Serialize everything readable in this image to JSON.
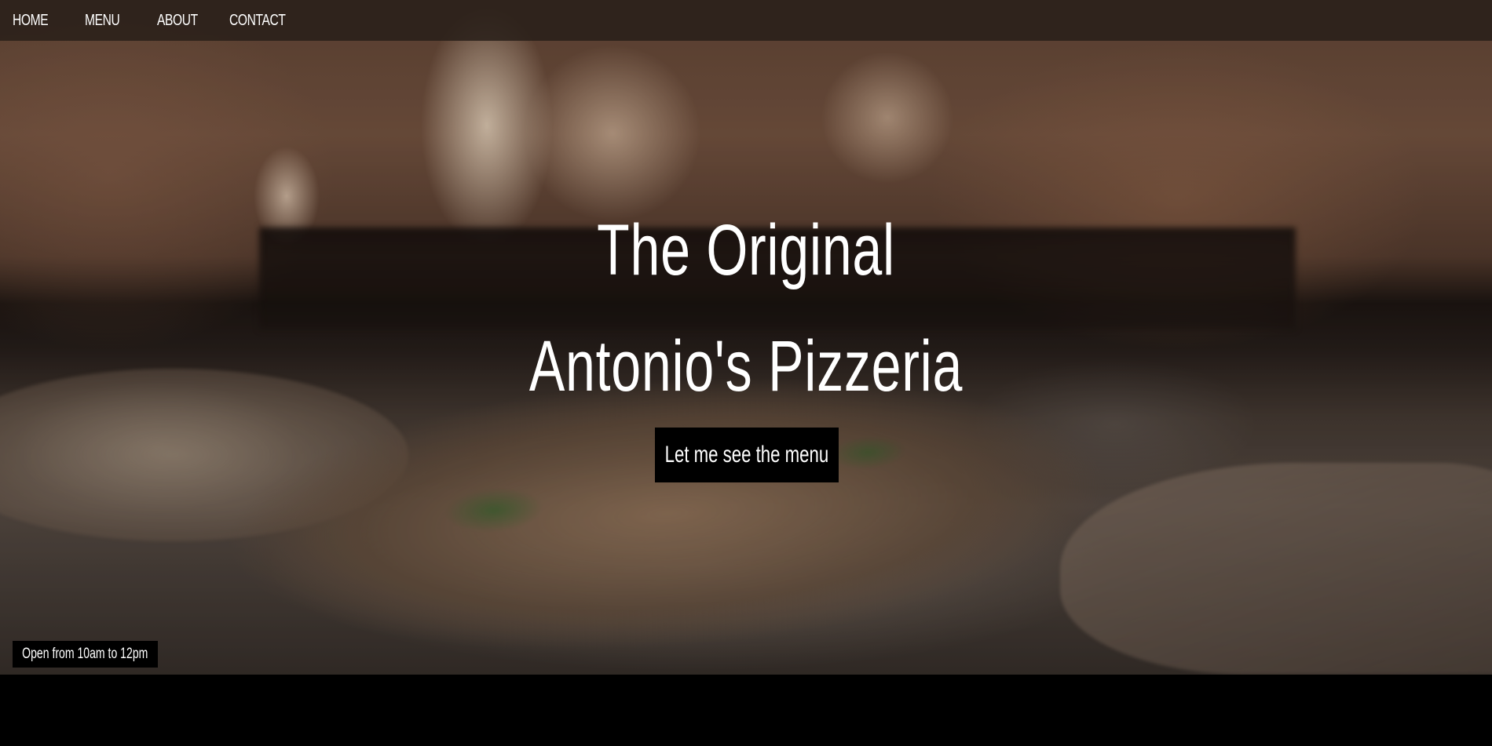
{
  "nav": {
    "items": [
      {
        "label": "HOME"
      },
      {
        "label": "MENU"
      },
      {
        "label": "ABOUT"
      },
      {
        "label": "CONTACT"
      }
    ]
  },
  "hero": {
    "title_line_1": "The Original",
    "title_line_2": "Antonio's Pizzeria",
    "cta_label": "Let me see the menu",
    "hours_text": "Open from 10am to 12pm"
  },
  "colors": {
    "nav_background": "#281e19",
    "button_background": "#000000",
    "text": "#ffffff",
    "page_background": "#000000"
  }
}
